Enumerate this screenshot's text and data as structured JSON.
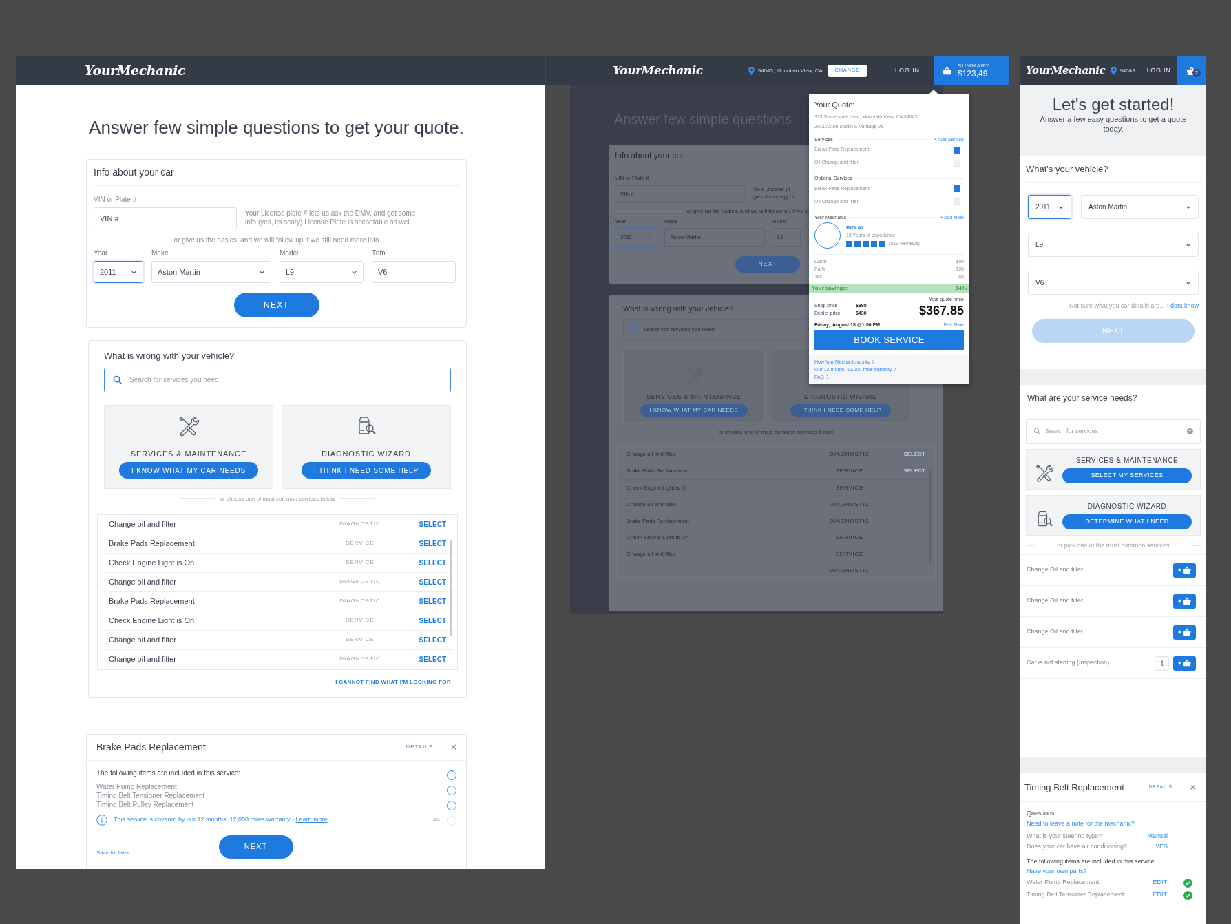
{
  "desktop": {
    "header": {
      "logo": "YourMechanic"
    },
    "title": "Answer few simple questions to get your quote.",
    "car_card": {
      "heading": "Info about your car",
      "vin_label": "VIN or Plate #",
      "vin_placeholder": "VIN #",
      "vin_hint": "Your License plate # lets us ask the DMV, and get some info (yes, its scary) License Plate is accpetable as well",
      "divider_text": "or give us the basics, and we will follow up if we still need more info",
      "fields": [
        {
          "label": "Year",
          "value": "2011",
          "kind": "select",
          "focused": true
        },
        {
          "label": "Make",
          "value": "Aston Martin",
          "kind": "select",
          "focused": false
        },
        {
          "label": "Model",
          "value": "L9",
          "kind": "select",
          "focused": false
        },
        {
          "label": "Trim",
          "value": "V6",
          "kind": "input",
          "focused": false
        }
      ],
      "next": "NEXT"
    },
    "problem_card": {
      "heading": "What is wrong with your vehicle?",
      "search_placeholder": "Search for services you need",
      "options": [
        {
          "kind": "wrench",
          "title": "SERVICES & MAINTENANCE",
          "button": "I KNOW WHAT MY CAR NEEDS"
        },
        {
          "kind": "diagnostic",
          "title": "DIAGNOSTIC WIZARD",
          "button": "I THINK I NEED SOME HELP"
        }
      ],
      "divider_text": "or choose one of most common services below",
      "services": [
        {
          "name": "Change oil and filter",
          "type": "DIAGNOSTIC",
          "action": "SELECT"
        },
        {
          "name": "Brake Pads Replacement",
          "type": "SERVICE",
          "action": "SELECT"
        },
        {
          "name": "Check Engine Light is On",
          "type": "SERVICE",
          "action": "SELECT"
        },
        {
          "name": "Change oil and filter",
          "type": "DIAGNOSTIC",
          "action": "SELECT"
        },
        {
          "name": "Brake Pads Replacement",
          "type": "DIAGNOSTIC",
          "action": "SELECT"
        },
        {
          "name": "Check Engine Light is On",
          "type": "SERVICE",
          "action": "SELECT"
        },
        {
          "name": "Change oil and filter",
          "type": "SERVICE",
          "action": "SELECT"
        },
        {
          "name": "Change oil and filter",
          "type": "DIAGNOSTIC",
          "action": "SELECT"
        }
      ],
      "cannot_find": "I CANNOT FIND WHAT I'M LOOKING FOR"
    },
    "detail_card": {
      "title": "Brake Pads Replacement",
      "details": "DETAILS",
      "intro": "The following items are included in this service:",
      "items": [
        "Water Pump Replacement",
        "Timing Belt Tensioner Replacement",
        "Timing Belt Pulley Replacement"
      ],
      "warranty": "This service is covered by our 12 months, 12,000 miles warranty - ",
      "learn_more": "Learn more",
      "counter": "4/4",
      "circles": [
        {
          "disabled": false
        },
        {
          "disabled": false
        },
        {
          "disabled": false
        },
        {
          "disabled": true
        }
      ],
      "save": "Save for later",
      "next": "NEXT"
    }
  },
  "popup_view": {
    "header": {
      "logo": "YourMechanic",
      "location": "94043, Mountain View, CA",
      "change": "CHANGE",
      "login": "LOG IN",
      "cart_label": "SUMMARY",
      "cart_total": "$123,49"
    },
    "background": {
      "title": "Answer few simple questions",
      "car_heading": "Info about your car",
      "vin_label": "VIN or Plate #",
      "vin_placeholder": "VIN #",
      "hint_lines": [
        "Your License pl",
        "(yes, its scary) Li"
      ],
      "divider_text": "or give us the basics, and we will follow up if we st",
      "fields": [
        {
          "label": "Year",
          "value": "2011",
          "focused": true
        },
        {
          "label": "Make",
          "value": "Aston Martin",
          "focused": false
        },
        {
          "label": "Model",
          "value": "L9",
          "focused": false
        }
      ],
      "next": "NEXT",
      "problem_heading": "What is wrong with your vehicle?",
      "search_placeholder": "Search for services you need",
      "options": [
        {
          "kind": "wrench",
          "title": "SERVICES & MAINTENANCE",
          "button": "I KNOW WHAT MY CAR NEEDS"
        },
        {
          "kind": "hidden",
          "title": "DIAGNOSTIC WIZARD",
          "button": "I THINK I NEED SOME HELP"
        }
      ],
      "divider_text_2": "or choose one of most common services below",
      "services": [
        {
          "name": "Change oil and filter",
          "type": "DIAGNOSTIC",
          "action": "SELECT"
        },
        {
          "name": "Brake Pads Replacement",
          "type": "SERVICE",
          "action": "SELECT"
        },
        {
          "name": "Check Engine Light is On",
          "type": "SERVICE"
        },
        {
          "name": "Change oil and filter",
          "type": "DIAGNOSTIC"
        },
        {
          "name": "Brake Pads Replacement",
          "type": "DIAGNOSTIC"
        },
        {
          "name": "Check Engine Light is On",
          "type": "SERVICE"
        },
        {
          "name": "Change oil and filter",
          "type": "SERVICE"
        },
        {
          "type": "DIAGNOSTIC"
        }
      ]
    },
    "quote": {
      "title": "Your Quote:",
      "address": "333 Some stree here, Mountain View, CA 94043",
      "car": "2011 Aston Martin S Vantage V6",
      "services_heading": "Services",
      "add_service": "+ Add Service",
      "services": [
        {
          "name": "Break Pads Replacement",
          "checked": true
        },
        {
          "name": "Oil Change and filter",
          "checked": false
        }
      ],
      "optional_heading": "Optional Services",
      "optional": [
        {
          "name": "Break Pads Replacement",
          "checked": true
        },
        {
          "name": "Oil Change and filter",
          "checked": false
        }
      ],
      "mechanic_heading": "Your Mechanic",
      "add_note": "+ Add Note",
      "mechanic": {
        "name": "BIG AL",
        "experience": "15 Years of experience",
        "stars": 5,
        "reviews": "(519 Reviews)"
      },
      "costs": [
        {
          "label": "Labor",
          "amount": "$50"
        },
        {
          "label": "Parts",
          "amount": "$20"
        },
        {
          "label": "Tax",
          "amount": "$5"
        }
      ],
      "savings_label": "Your savings:",
      "savings": "14%",
      "shop_label": "Shop price",
      "shop": "$395",
      "dealer_label": "Dealer price",
      "dealer": "$430",
      "quote_label": "Your quote price",
      "quote_price": "$367.85",
      "time": "Friday,  August 18 @1:00 PM",
      "edit_time": "Edit Time",
      "book": "BOOK SERVICE",
      "links": [
        "How YourMechanic works",
        "Our 12-month, 12,000-mile warranty",
        "FAQ"
      ]
    }
  },
  "mobile": {
    "header": {
      "logo": "YourMechanic",
      "zip": "94043",
      "login": "LOG IN",
      "cart_count": "2"
    },
    "hero": {
      "title": "Let's get started!",
      "subtitle": "Answer a few easy questions to get a quote today."
    },
    "vehicle": {
      "heading": "What's your vehicle?",
      "selects": [
        {
          "value": "2011",
          "focused": true
        },
        {
          "value": "Aston Martin",
          "focused": false
        },
        {
          "value": "L9",
          "focused": false
        },
        {
          "value": "V6",
          "focused": false
        }
      ],
      "hint": "Not sure what you car details are...",
      "hint_link": "I dont know",
      "next": "NEXT",
      "next_disabled": true
    },
    "needs": {
      "heading": "What are your service needs?",
      "search_placeholder": "Search for services",
      "options": [
        {
          "kind": "wrench",
          "title": "SERVICES & MAINTENANCE",
          "button": "SELECT MY SERVICES"
        },
        {
          "kind": "diagnostic",
          "title": "DIAGNOSTIC WIZARD",
          "button": "DETERMINE WHAT I NEED"
        }
      ],
      "divider_text": "or pick one of the most common services",
      "services": [
        {
          "name": "Change Oil and filter",
          "info": false
        },
        {
          "name": "Change Oil and filter",
          "info": false
        },
        {
          "name": "Change Oil and filter",
          "info": false
        },
        {
          "name": "Car is not starting (Inspection)",
          "info": true
        }
      ]
    },
    "detail": {
      "title": "Timing Belt Replacement",
      "details": "DETAILS",
      "questions_heading": "Questions:",
      "note_link": "Need to leave a note for the mechanic?",
      "questions": [
        {
          "question": "What is your steering type?",
          "answer": "Manual"
        },
        {
          "question": "Does your car have air conditioning?",
          "answer": "YES"
        }
      ],
      "intro": "The following items are included in this service:",
      "parts_link": "Have your own parts?",
      "items": [
        {
          "name": "Water Pump Replacement",
          "action": "EDIT",
          "checked": true
        },
        {
          "name": "Timing Belt Tensioner Replacement",
          "action": "EDIT",
          "checked": true
        }
      ]
    }
  }
}
